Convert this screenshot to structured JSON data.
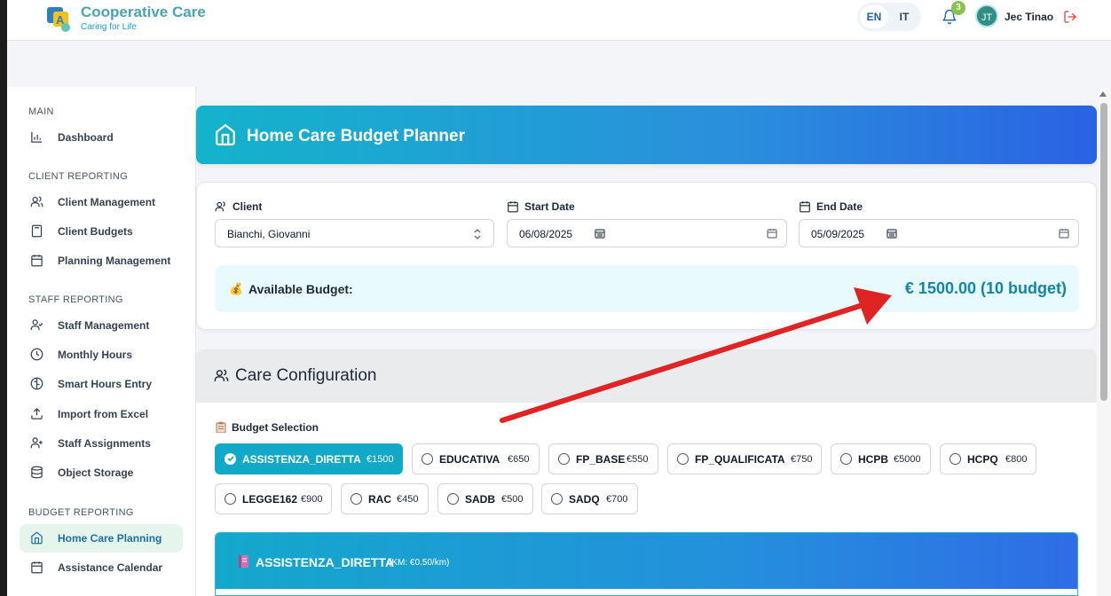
{
  "app": {
    "title": "Cooperative Care",
    "subtitle": "Caring for Life"
  },
  "header": {
    "languages": [
      "EN",
      "IT"
    ],
    "active_language": "EN",
    "notification_count": "3",
    "user_initials": "JT",
    "user_name": "Jec Tinao"
  },
  "sidebar": {
    "sections": [
      {
        "title": "MAIN",
        "items": [
          {
            "label": "Dashboard",
            "icon": "chart-icon"
          }
        ]
      },
      {
        "title": "CLIENT REPORTING",
        "items": [
          {
            "label": "Client Management",
            "icon": "users-icon"
          },
          {
            "label": "Client Budgets",
            "icon": "calculator-icon"
          },
          {
            "label": "Planning Management",
            "icon": "calendar-icon"
          }
        ]
      },
      {
        "title": "STAFF REPORTING",
        "items": [
          {
            "label": "Staff Management",
            "icon": "user-check-icon"
          },
          {
            "label": "Monthly Hours",
            "icon": "clock-icon"
          },
          {
            "label": "Smart Hours Entry",
            "icon": "brain-icon"
          },
          {
            "label": "Import from Excel",
            "icon": "upload-icon"
          },
          {
            "label": "Staff Assignments",
            "icon": "user-plus-icon"
          },
          {
            "label": "Object Storage",
            "icon": "database-icon"
          }
        ]
      },
      {
        "title": "BUDGET REPORTING",
        "items": [
          {
            "label": "Home Care Planning",
            "icon": "home-icon",
            "active": true
          },
          {
            "label": "Assistance Calendar",
            "icon": "calendar-icon"
          }
        ]
      }
    ]
  },
  "page": {
    "title": "Home Care Budget Planner"
  },
  "form": {
    "client_label": "Client",
    "client_value": "Bianchi, Giovanni",
    "start_label": "Start Date",
    "start_value": "06/08/2025",
    "end_label": "End Date",
    "end_value": "05/09/2025",
    "budget_label": "Available Budget:",
    "budget_emoji": "💰",
    "budget_amount": "€ 1500.00 (10 budget)"
  },
  "care": {
    "title": "Care Configuration",
    "selection_label": "Budget Selection",
    "options": [
      {
        "name": "ASSISTENZA_DIRETTA",
        "price": "€1500",
        "selected": true
      },
      {
        "name": "EDUCATIVA",
        "price": "€650"
      },
      {
        "name": "FP_BASE",
        "price": "€550"
      },
      {
        "name": "FP_QUALIFICATA",
        "price": "€750"
      },
      {
        "name": "HCPB",
        "price": "€5000"
      },
      {
        "name": "HCPQ",
        "price": "€800"
      },
      {
        "name": "LEGGE162",
        "price": "€900"
      },
      {
        "name": "RAC",
        "price": "€450"
      },
      {
        "name": "SADB",
        "price": "€500"
      },
      {
        "name": "SADQ",
        "price": "€700"
      }
    ],
    "service_title": "ASSISTENZA_DIRETTA",
    "service_km": "(KM: €0.50/km)"
  },
  "colors": {
    "accent": "#12a8c8",
    "budget_amount": "#1087a6",
    "annotation_arrow": "#e02424",
    "active_nav_bg": "#e6f5ec"
  }
}
